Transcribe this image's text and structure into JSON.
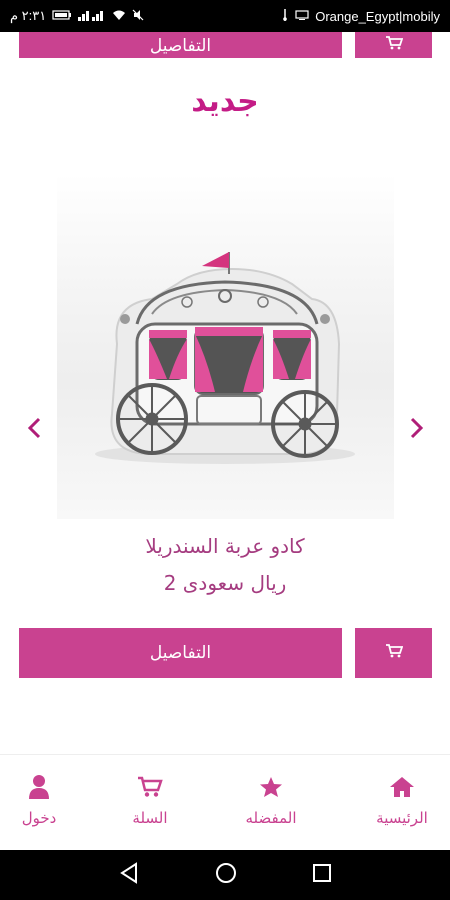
{
  "status_bar": {
    "time": "٢:٣١ م",
    "carrier": "Orange_Egypt|mobily"
  },
  "top_row": {
    "details_label": "التفاصيل"
  },
  "section": {
    "title": "جديد"
  },
  "product": {
    "name": "كادو عربة السندريلا",
    "price": "2 ريال سعودى",
    "details_label": "التفاصيل"
  },
  "bottom_nav": {
    "items": [
      {
        "label": "الرئيسية",
        "icon": "home-icon"
      },
      {
        "label": "المفضله",
        "icon": "star-icon"
      },
      {
        "label": "السلة",
        "icon": "cart-icon"
      },
      {
        "label": "دخول",
        "icon": "user-icon"
      }
    ]
  },
  "colors": {
    "accent": "#c94290",
    "title": "#c41c86",
    "text": "#a53c80"
  }
}
